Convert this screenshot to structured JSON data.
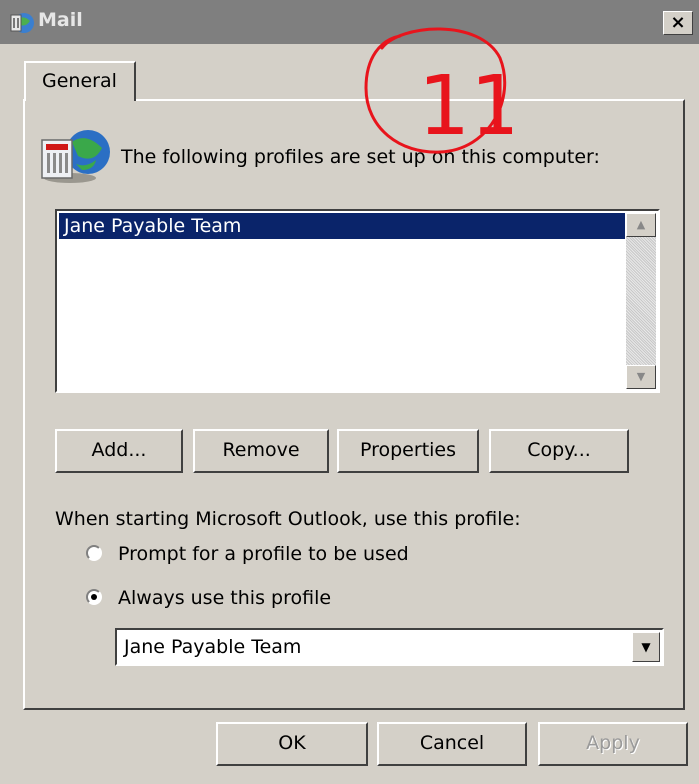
{
  "window": {
    "title": "Mail",
    "close_glyph": "×"
  },
  "tabs": [
    {
      "label": "General"
    }
  ],
  "intro_text": "The following profiles are set up on this computer:",
  "profiles_list": {
    "items": [
      "Jane Payable Team"
    ],
    "selected_index": 0
  },
  "actions": {
    "add": "Add...",
    "remove": "Remove",
    "properties": "Properties",
    "copy": "Copy..."
  },
  "startup": {
    "label": "When starting Microsoft Outlook, use this profile:",
    "options": [
      {
        "label": "Prompt for a profile to be used",
        "checked": false
      },
      {
        "label": "Always use this profile",
        "checked": true
      }
    ],
    "profile_select_value": "Jane Payable Team"
  },
  "footer": {
    "ok": "OK",
    "cancel": "Cancel",
    "apply": "Apply",
    "apply_disabled": true
  },
  "annotation": {
    "text": "11",
    "color": "#e8141c"
  },
  "colors": {
    "dialog_face": "#d4d0c8",
    "titlebar_inactive": "#7f7f7f",
    "selection": "#0a246a"
  },
  "icons": {
    "app": "mail-app-icon",
    "profiles": "profiles-server-globe-icon",
    "close": "close-icon",
    "scroll_up": "scroll-up-icon",
    "scroll_down": "scroll-down-icon",
    "dropdown": "chevron-down-icon"
  }
}
